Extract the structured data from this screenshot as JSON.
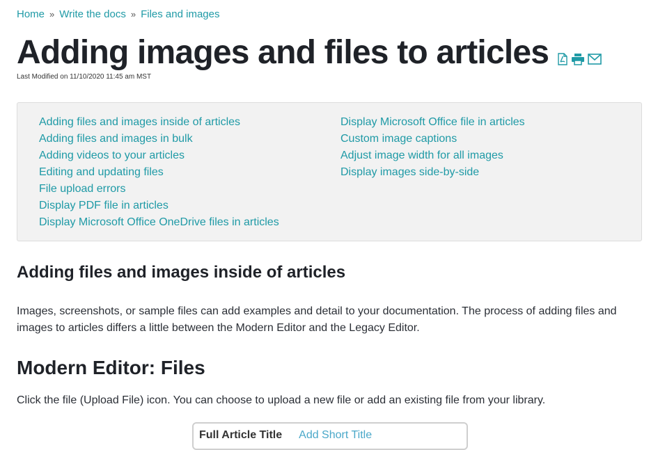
{
  "breadcrumb": {
    "home": "Home",
    "sep": "»",
    "section": "Write the docs",
    "current": "Files and images"
  },
  "page": {
    "title": "Adding images and files to articles",
    "modified": "Last Modified on 11/10/2020 11:45 am MST"
  },
  "icons": [
    "pdf-icon",
    "print-icon",
    "email-icon"
  ],
  "toc": {
    "col1": [
      "Adding files and images inside of articles",
      "Adding files and images in bulk",
      "Adding videos to your articles",
      "Editing and updating files",
      "File upload errors",
      "Display PDF file in articles",
      "Display Microsoft Office OneDrive files in articles"
    ],
    "col2": [
      "Display Microsoft Office file in articles",
      "Custom image captions",
      "Adjust image width for all images",
      "Display images side-by-side"
    ]
  },
  "section1": {
    "heading": "Adding files and images inside of articles",
    "body": "Images, screenshots, or sample files can add examples and detail to your documentation. The process of adding files and images to articles differs a little between the Modern Editor and the Legacy Editor."
  },
  "section2": {
    "heading": "Modern Editor: Files",
    "body": "Click the file (Upload File) icon. You can choose to upload a new file or add an existing file from your library."
  },
  "screenshot": {
    "full_title": "Full Article Title",
    "short_title": "Add Short Title"
  },
  "colors": {
    "link": "#1f9aa6",
    "heading": "#1f2228",
    "toc_bg": "#f2f2f2"
  }
}
